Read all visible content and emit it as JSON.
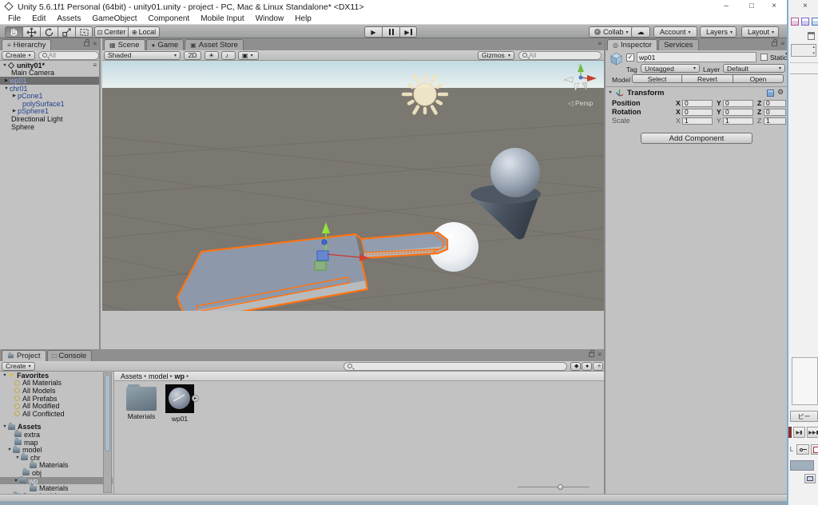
{
  "colors": {
    "selection_orange": "#FF7312",
    "prefab_blue": "#24418F",
    "panel_bg": "#C2C2C2",
    "sky_top": "#C2DAE3",
    "ground": "#7B7771"
  },
  "title_bar": {
    "title": "Unity 5.6.1f1 Personal (64bit) - unity01.unity - project - PC, Mac & Linux Standalone* <DX11>",
    "minimize": "–",
    "maximize": "□",
    "close": "×"
  },
  "menu": {
    "items": [
      "File",
      "Edit",
      "Assets",
      "GameObject",
      "Component",
      "Mobile Input",
      "Window",
      "Help"
    ]
  },
  "toolbar": {
    "center": "Center",
    "local": "Local",
    "collab": "Collab",
    "account": "Account",
    "layers": "Layers",
    "layout": "Layout"
  },
  "hierarchy": {
    "tab": "Hierarchy",
    "create": "Create",
    "search_placeholder": "All",
    "scene_name": "unity01*",
    "items": [
      {
        "label": "Main Camera"
      },
      {
        "label": "wp01"
      },
      {
        "label": "chr01"
      },
      {
        "label": "pCone1"
      },
      {
        "label": "polySurface1"
      },
      {
        "label": "pSphere1"
      },
      {
        "label": "Directional Light"
      },
      {
        "label": "Sphere"
      }
    ]
  },
  "scene_view": {
    "tab_scene": "Scene",
    "tab_game": "Game",
    "tab_asset_store": "Asset Store",
    "shading_mode": "Shaded",
    "toggle_2d": "2D",
    "gizmos": "Gizmos",
    "search_placeholder": "All",
    "persp": "Persp",
    "axis_y": "y"
  },
  "inspector": {
    "tab_inspector": "Inspector",
    "tab_services": "Services",
    "name": "wp01",
    "static": "Static",
    "tag_label": "Tag",
    "tag_value": "Untagged",
    "layer_label": "Layer",
    "layer_value": "Default",
    "model_label": "Model",
    "select": "Select",
    "revert": "Revert",
    "open": "Open",
    "transform": {
      "title": "Transform",
      "position_label": "Position",
      "rotation_label": "Rotation",
      "scale_label": "Scale",
      "x": "X",
      "y": "Y",
      "z": "Z",
      "position": {
        "x": "0",
        "y": "0",
        "z": "0"
      },
      "rotation": {
        "x": "0",
        "y": "0",
        "z": "0"
      },
      "scale": {
        "x": "1",
        "y": "1",
        "z": "1"
      }
    },
    "add_component": "Add Component"
  },
  "project": {
    "tab_project": "Project",
    "tab_console": "Console",
    "create": "Create",
    "favorites_label": "Favorites",
    "favorites": [
      {
        "label": "All Materials"
      },
      {
        "label": "All Models"
      },
      {
        "label": "All Prefabs"
      },
      {
        "label": "All Modified"
      },
      {
        "label": "All Conflicted"
      }
    ],
    "assets_label": "Assets",
    "tree": [
      {
        "label": "extra"
      },
      {
        "label": "map"
      },
      {
        "label": "model"
      },
      {
        "label": "chr"
      },
      {
        "label": "Materials"
      },
      {
        "label": "obj"
      },
      {
        "label": "wp"
      },
      {
        "label": "Materials"
      },
      {
        "label": "Standard Assets"
      }
    ],
    "breadcrumb": {
      "root": "Assets",
      "mid": "model",
      "current": "wp"
    },
    "items": [
      {
        "label": "Materials"
      },
      {
        "label": "wp01"
      }
    ]
  },
  "side_window": {
    "close": "×",
    "copy": "ピー",
    "step": "▶▮",
    "ffwd": "▶▶▮"
  }
}
